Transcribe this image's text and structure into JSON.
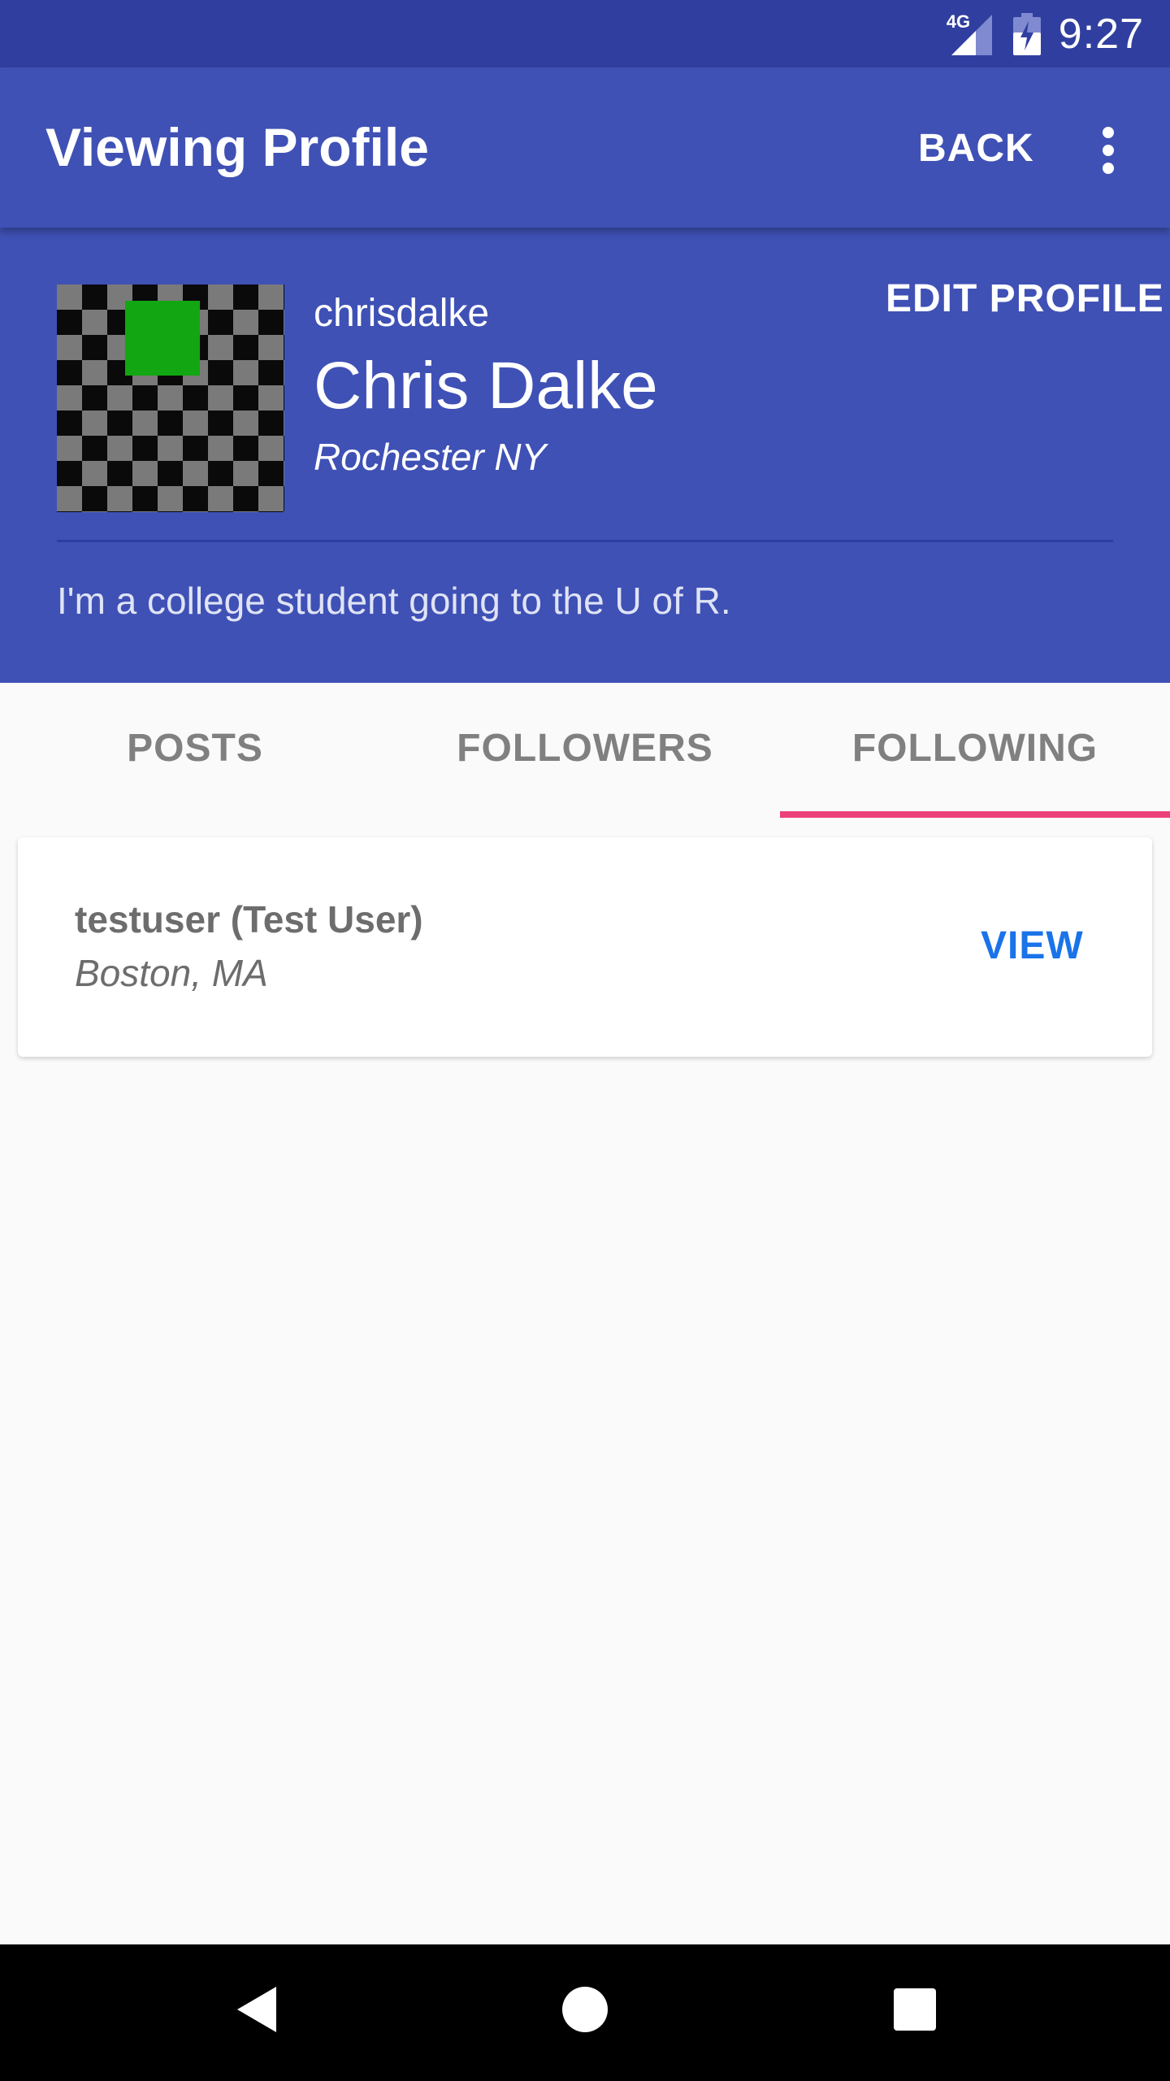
{
  "status_bar": {
    "network": "4G",
    "time": "9:27",
    "icons": [
      "signal-icon",
      "battery-charging-icon"
    ]
  },
  "app_bar": {
    "title": "Viewing Profile",
    "back_label": "BACK",
    "menu_icon": "overflow-menu-icon"
  },
  "profile": {
    "username": "chrisdalke",
    "full_name": "Chris Dalke",
    "location": "Rochester NY",
    "edit_label": "EDIT PROFILE",
    "bio": "I'm a college student going to the U of R."
  },
  "tabs": [
    {
      "label": "POSTS",
      "selected": false
    },
    {
      "label": "FOLLOWERS",
      "selected": false
    },
    {
      "label": "FOLLOWING",
      "selected": true
    }
  ],
  "following": [
    {
      "name": "testuser (Test User)",
      "location": "Boston, MA",
      "action_label": "VIEW"
    }
  ],
  "nav_bar": {
    "icons": [
      "back-nav-icon",
      "home-nav-icon",
      "recents-nav-icon"
    ]
  },
  "colors": {
    "primary": "#3f51b5",
    "primary_dark": "#303f9f",
    "accent": "#ec407a",
    "link": "#1a73e8"
  }
}
